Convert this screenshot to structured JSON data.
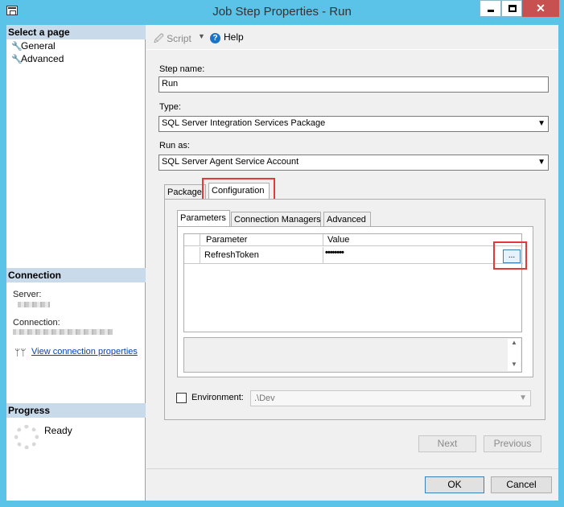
{
  "window": {
    "title": "Job Step Properties - Run",
    "close_label": "✕"
  },
  "left": {
    "select_page_header": "Select a page",
    "pages": [
      {
        "label": "General"
      },
      {
        "label": "Advanced"
      }
    ],
    "connection_header": "Connection",
    "server_label": "Server:",
    "connection_label": "Connection:",
    "view_link": "View connection properties",
    "progress_header": "Progress",
    "progress_status": "Ready"
  },
  "toolbar": {
    "script_label": "Script",
    "help_label": "Help"
  },
  "form": {
    "step_name_label": "Step name:",
    "step_name_value": "Run",
    "type_label": "Type:",
    "type_value": "SQL Server Integration Services Package",
    "run_as_label": "Run as:",
    "run_as_value": "SQL Server Agent Service Account"
  },
  "outer_tabs": [
    {
      "label": "Package"
    },
    {
      "label": "Configuration"
    }
  ],
  "inner_tabs": [
    {
      "label": "Parameters"
    },
    {
      "label": "Connection Managers"
    },
    {
      "label": "Advanced"
    }
  ],
  "grid": {
    "headers": {
      "parameter": "Parameter",
      "value": "Value"
    },
    "rows": [
      {
        "parameter": "RefreshToken",
        "value": "••••••••"
      }
    ],
    "ellipsis_label": "..."
  },
  "environment": {
    "label": "Environment:",
    "value": ".\\Dev",
    "checked": false
  },
  "buttons": {
    "next": "Next",
    "previous": "Previous",
    "ok": "OK",
    "cancel": "Cancel"
  },
  "colors": {
    "title_bar": "#5bc2e8",
    "highlight": "#e03a3a",
    "pane_header": "#c9daea",
    "link": "#0645ad"
  }
}
